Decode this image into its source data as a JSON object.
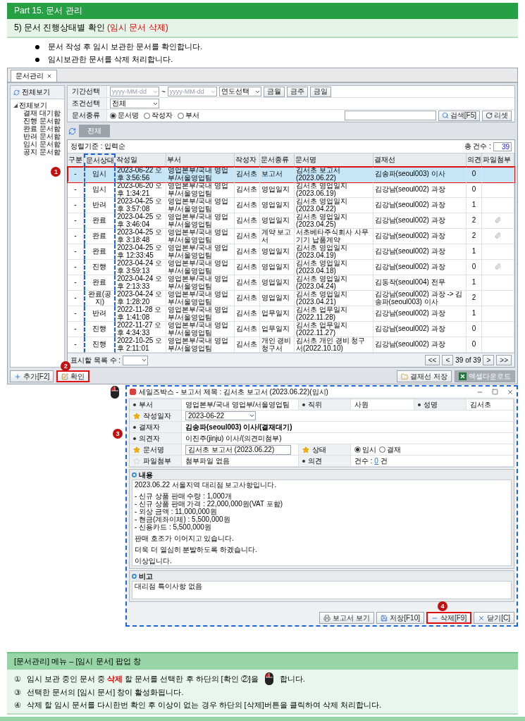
{
  "page": {
    "part": "Part 15. 문서 관리",
    "subtitle": "5) 문서 진행상태별 확인 **(임시 문서 삭제)**"
  },
  "bullets": [
    "문서 작성 후 임시 보관한 문서를 확인합니다.",
    "임시보관한 문서를 삭제 처리합니다."
  ],
  "app": {
    "tab": "문서관리",
    "sidebar": {
      "header": "전체보기",
      "tree": [
        {
          "label": "전체보기",
          "expanded": true,
          "children": [
            {
              "label": "결재 대기함"
            },
            {
              "label": "진행 문서함"
            },
            {
              "label": "완료 문서함"
            },
            {
              "label": "반려 문서함"
            },
            {
              "label": "임시 문서함"
            },
            {
              "label": "공지 문서함"
            }
          ]
        }
      ]
    },
    "filters": [
      {
        "kind": "period",
        "label": "기간선택",
        "from_placeholder": "yyyy-MM-dd",
        "separator": "~",
        "to_placeholder": "yyyy-MM-dd",
        "select": "연도선택",
        "buttons": [
          "금월",
          "금주",
          "금일"
        ]
      },
      {
        "kind": "select",
        "label": "조건선택",
        "value": "전체"
      },
      {
        "kind": "radio",
        "label": "문서종류",
        "options": [
          {
            "label": "문서명",
            "selected": true
          },
          {
            "label": "작성자",
            "selected": false
          },
          {
            "label": "부서",
            "selected": false
          }
        ]
      }
    ],
    "search_button": "검색[F5]",
    "reset_button": "리셋",
    "view_button": "전체",
    "sort_label": "정렬기준 : 입력순",
    "total_label": "총 건수 :",
    "total": "39",
    "columns": [
      {
        "label": "구분",
        "highlighted": false
      },
      {
        "label": "문서상태",
        "highlighted": true
      },
      {
        "label": "작성일",
        "highlighted": false
      },
      {
        "label": "부서",
        "highlighted": false
      },
      {
        "label": "작성자",
        "highlighted": false
      },
      {
        "label": "문서종류",
        "highlighted": false
      },
      {
        "label": "문서명",
        "highlighted": false
      },
      {
        "label": "결재선",
        "highlighted": false
      },
      {
        "label": "의견",
        "highlighted": false
      },
      {
        "label": "파일첨부",
        "highlighted": false
      }
    ],
    "rows": [
      {
        "cells": [
          "-",
          "임시",
          "2023-06-22 오후 3:56:56",
          "영업본부/국내 영업부/서울영업팀",
          "김서초",
          "보고서",
          "김서초 보고서 (2023.06.22)",
          "김송파(seoul003) 이사",
          "0"
        ],
        "attachment": false,
        "selected": true,
        "callout": "1"
      },
      {
        "cells": [
          "-",
          "임시",
          "2023-06-20 오후 1:34:21",
          "영업본부/국내 영업부/서울영업팀",
          "김서초",
          "영업일지",
          "김서초 영업일지 (2023.06.19)",
          "김강남(seoul002) 과장",
          "0"
        ],
        "attachment": false,
        "selected": false
      },
      {
        "cells": [
          "-",
          "반려",
          "2023-04-25 오후 3:57:08",
          "영업본부/국내 영업부/서울영업팀",
          "김서초",
          "영업일지",
          "김서초 영업일지 (2023.04.22)",
          "김강남(seoul002) 과장",
          "1"
        ],
        "attachment": false,
        "selected": false
      },
      {
        "cells": [
          "-",
          "완료",
          "2023-04-25 오후 3:46:04",
          "영업본부/국내 영업부/서울영업팀",
          "김서초",
          "영업일지",
          "김서초 영업일지 (2023.04.25)",
          "김강남(seoul002) 과장",
          "2"
        ],
        "attachment": true,
        "selected": false
      },
      {
        "cells": [
          "-",
          "완료",
          "2023-04-25 오후 3:18:48",
          "영업본부/국내 영업부/서울영업팀",
          "김서초",
          "계약 보고서",
          "서초베타주식회사 사무기기 납품계약",
          "김강남(seoul002) 과장",
          "2"
        ],
        "attachment": true,
        "selected": false
      },
      {
        "cells": [
          "-",
          "완료",
          "2023-04-25 오후 12:33:45",
          "영업본부/국내 영업부/서울영업팀",
          "김서초",
          "영업일지",
          "김서초 영업일지 (2023.04.19)",
          "김강남(seoul002) 과장",
          "1"
        ],
        "attachment": false,
        "selected": false
      },
      {
        "cells": [
          "-",
          "진행",
          "2023-04-24 오후 3:59:13",
          "영업본부/국내 영업부/서울영업팀",
          "김서초",
          "영업일지",
          "김서초 영업일지 (2023.04.18)",
          "김강남(seoul002) 과장",
          "0"
        ],
        "attachment": true,
        "selected": false
      },
      {
        "cells": [
          "-",
          "완료",
          "2023-04-24 오후 2:13:33",
          "영업본부/국내 영업부/서울영업팀",
          "김서초",
          "영업일지",
          "김서초 영업일지 (2023.04.24)",
          "김동작(seoul004) 전무",
          "1"
        ],
        "attachment": false,
        "selected": false
      },
      {
        "cells": [
          "-",
          "완료(공지)",
          "2023-04-24 오후 1:28:20",
          "영업본부/국내 영업부/서울영업팀",
          "김서초",
          "영업일지",
          "김서초 영업일지 (2023.04.21)",
          "김강남(seoul002) 과장 -> 김송파(seoul003) 이사",
          "2"
        ],
        "attachment": false,
        "selected": false
      },
      {
        "cells": [
          "-",
          "반려",
          "2022-11-28 오후 1:41:08",
          "영업본부/국내 영업부/서울영업팀",
          "김서초",
          "업무일지",
          "김서초 업무일지 (2022.11.28)",
          "김강남(seoul002) 과장",
          "1"
        ],
        "attachment": false,
        "selected": false
      },
      {
        "cells": [
          "-",
          "진행",
          "2022-11-27 오후 4:34:33",
          "영업본부/국내 영업부/서울영업팀",
          "김서초",
          "업무일지",
          "김서초 업무일지 (2022.11.27)",
          "김강남(seoul002) 과장",
          "0"
        ],
        "attachment": false,
        "selected": false
      },
      {
        "cells": [
          "-",
          "진행",
          "2022-10-25 오후 2:11:01",
          "영업본부/국내 영업부/서울영업팀",
          "김서초",
          "개인 경비 청구서",
          "김서초 개인 경비 청구서(2022.10.10)",
          "김강남(seoul002) 과장",
          "0"
        ],
        "attachment": false,
        "selected": false
      }
    ],
    "page_size_label": "표시할 목록 수 :",
    "pager": {
      "first": "<<",
      "prev": "<",
      "info": "39 of 39",
      "next": ">",
      "last": ">>"
    },
    "left_buttons": [
      {
        "label": "추가[F2]"
      },
      {
        "label": "확인",
        "callout": "2"
      }
    ],
    "right_buttons": [
      {
        "label": "결재선 저장"
      },
      {
        "label": "엑셀다운로드"
      }
    ]
  },
  "popup": {
    "title": "세일즈박스 - 보고서 제목 : 김서초 보고서 (2023.06.22)(임시)",
    "callout": "3",
    "field_rows": [
      [
        {
          "label": "부서",
          "kind": "text",
          "value": "영업본부/국내 영업부/서울영업팀"
        },
        {
          "label": "직위",
          "kind": "text",
          "value": "사원"
        },
        {
          "label": "성명",
          "kind": "text",
          "value": "김서초"
        }
      ],
      [
        {
          "label": "작성일자",
          "required": true,
          "kind": "date",
          "value": "2023-06-22"
        }
      ],
      [
        {
          "label": "결재자",
          "kind": "bold",
          "value": "김송파(seoul003) 이사/(결재대기)"
        }
      ],
      [
        {
          "label": "의견자",
          "kind": "text",
          "value": "이진주(jinju) 이사/(의견미첨부)"
        }
      ],
      [
        {
          "label": "문서명",
          "required": true,
          "kind": "input",
          "value": "김서초 보고서 (2023.06.22)"
        },
        {
          "label": "상태",
          "required": true,
          "kind": "radio",
          "options": [
            {
              "label": "임시",
              "selected": true
            },
            {
              "label": "결재",
              "selected": false
            }
          ]
        }
      ],
      [
        {
          "label": "파일첨부",
          "required": false,
          "kind": "text",
          "value": "첨부파일 없음"
        },
        {
          "label": "의견",
          "kind": "count",
          "prefix": "건수 :",
          "count": "0",
          "suffix": "건"
        }
      ]
    ],
    "content": {
      "title": "내용",
      "paragraphs": [
        [
          "2023.06.22 서울지역 대리점 보고사항입니다."
        ],
        [
          "- 신규 상품 판매 수량 : 1,000개",
          "- 신규 상품 판매 가격 : 22,000,000원(VAT 포함)",
          "- 외상 금액 : 11,000,000원",
          "- 현금(계좌이체) : 5,500,000원",
          "- 신용카드 : 5,500,000원"
        ],
        [
          "판매 호조가 이어지고 있습니다."
        ],
        [
          "더욱 더 열심히 분발하도록 하겠습니다."
        ],
        [
          "이상입니다."
        ]
      ]
    },
    "note": {
      "title": "비고",
      "text": "대리점 특이사항 없음"
    },
    "buttons": [
      {
        "label": "보고서 보기"
      },
      {
        "label": "저장[F10]"
      },
      {
        "label": "삭제[F9]",
        "callout": "4"
      },
      {
        "label": "닫기[C]"
      }
    ]
  },
  "guide": {
    "title": "[문서관리] 메뉴 – [임시 문서] 팝업 창",
    "steps": [
      {
        "num": "①",
        "text": "임시 보관 중인 문서 중 **삭제** 할 문서를 선택한 후 하단의 [확인 ②]을",
        "mouse": true,
        "after": "합니다."
      },
      {
        "num": "③",
        "text": "선택한 문서의 [임시 문서] 창이 활성화됩니다.",
        "mouse": false
      },
      {
        "num": "④",
        "text": "삭제 할 임시 문서를 다시한번 확인 후 이상이 없는 경우 하단의 [삭제]버튼을 클릭하여 삭제 처리합니다.",
        "mouse": false
      }
    ]
  }
}
